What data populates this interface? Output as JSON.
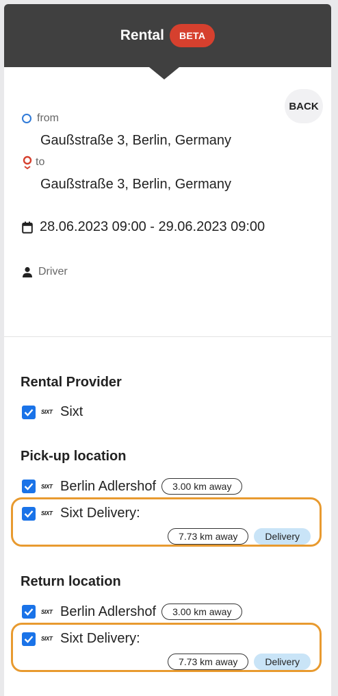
{
  "header": {
    "title": "Rental",
    "badge": "BETA"
  },
  "back_label": "BACK",
  "route": {
    "from_label": "from",
    "from_address": "Gaußstraße 3, Berlin, Germany",
    "to_label": "to",
    "to_address": "Gaußstraße 3, Berlin, Germany"
  },
  "date_range": "28.06.2023 09:00 - 29.06.2023 09:00",
  "driver_label": "Driver",
  "provider_section": {
    "title": "Rental Provider",
    "items": [
      {
        "logo": "SIXT",
        "name": "Sixt",
        "checked": true
      }
    ]
  },
  "pickup_section": {
    "title": "Pick-up location",
    "items": [
      {
        "logo": "SIXT",
        "name": "Berlin Adlershof",
        "distance": "3.00 km away",
        "checked": true
      },
      {
        "logo": "SIXT",
        "name": "Sixt Delivery:",
        "distance": "7.73 km away",
        "tag": "Delivery",
        "checked": true
      }
    ]
  },
  "return_section": {
    "title": "Return location",
    "items": [
      {
        "logo": "SIXT",
        "name": "Berlin Adlershof",
        "distance": "3.00 km away",
        "checked": true
      },
      {
        "logo": "SIXT",
        "name": "Sixt Delivery:",
        "distance": "7.73 km away",
        "tag": "Delivery",
        "checked": true
      }
    ]
  },
  "colors": {
    "header": "#404040",
    "beta": "#d6402e",
    "checkbox": "#1a73e8",
    "highlight": "#e89a2f",
    "delivery_tag": "#c9e4f7"
  }
}
